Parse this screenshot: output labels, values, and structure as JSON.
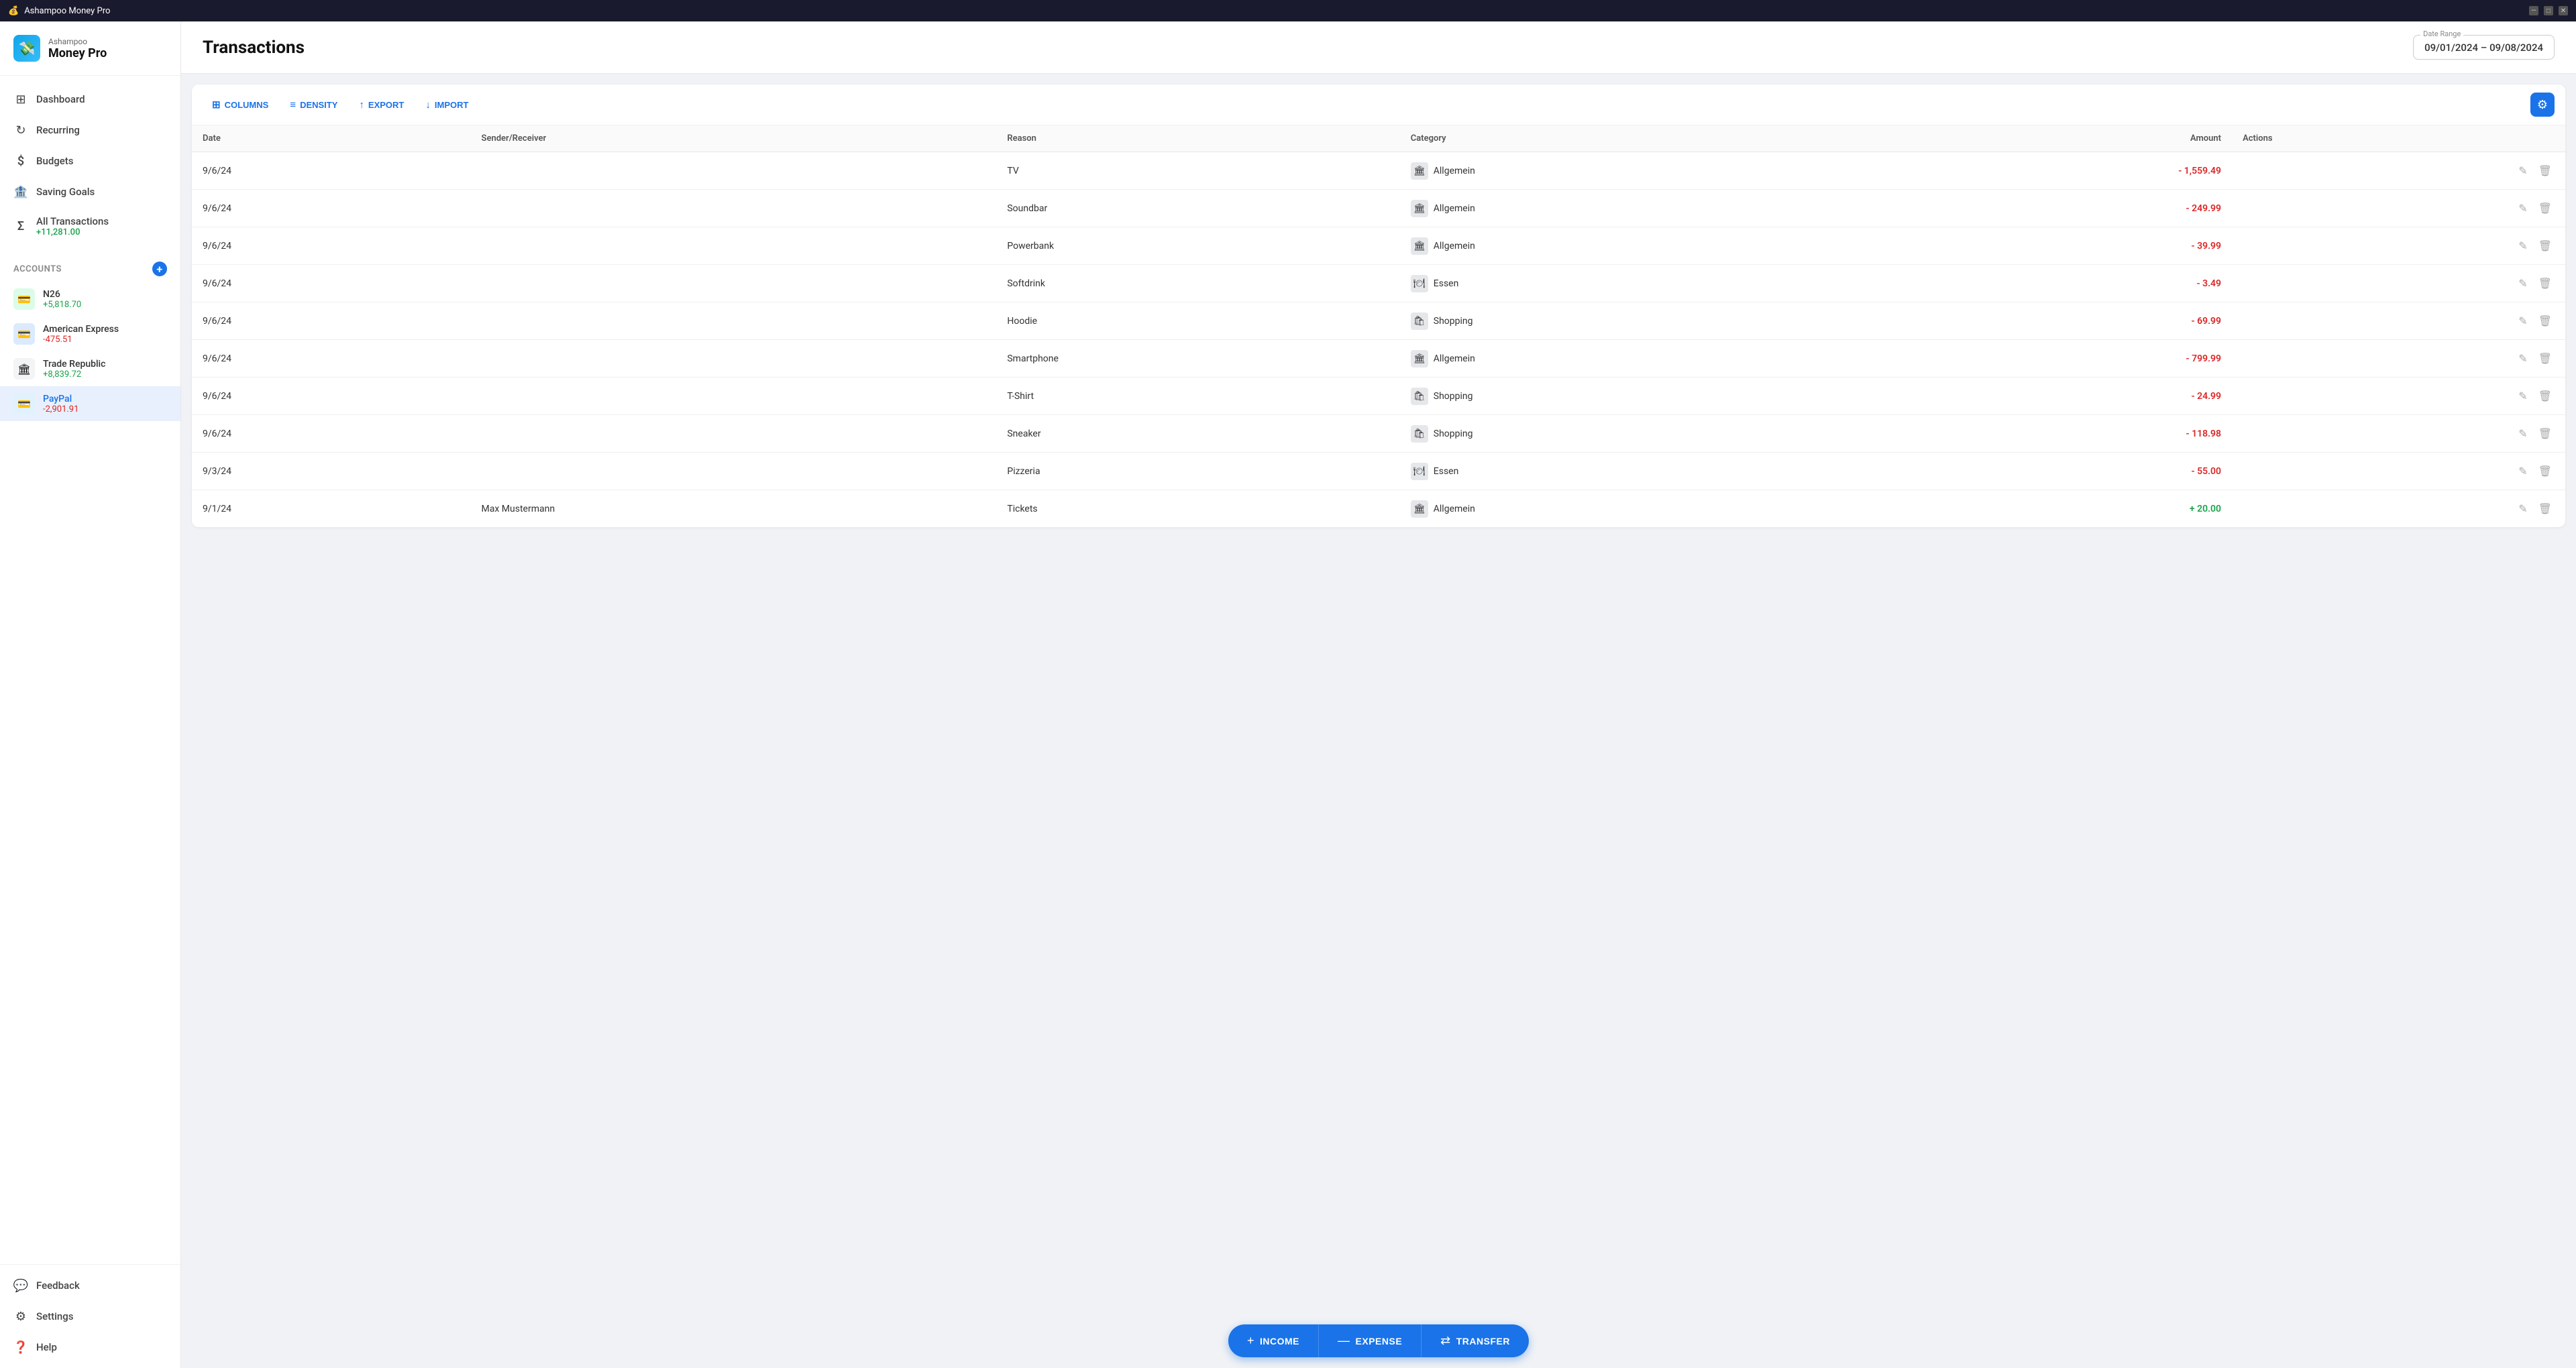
{
  "app": {
    "company": "Ashampoo",
    "product": "Money Pro",
    "title": "Ashampoo Money Pro"
  },
  "titlebar": {
    "minimize": "—",
    "maximize": "□",
    "close": "✕"
  },
  "sidebar": {
    "nav": [
      {
        "id": "dashboard",
        "label": "Dashboard",
        "icon": "⊞"
      },
      {
        "id": "recurring",
        "label": "Recurring",
        "icon": "↻"
      },
      {
        "id": "budgets",
        "label": "Budgets",
        "icon": "💲"
      },
      {
        "id": "saving-goals",
        "label": "Saving Goals",
        "icon": "🏦"
      },
      {
        "id": "all-transactions",
        "label": "All Transactions",
        "icon": "Σ",
        "sub": "+11,281.00",
        "sub_type": "positive"
      }
    ],
    "accounts_label": "Accounts",
    "accounts": [
      {
        "id": "n26",
        "name": "N26",
        "balance": "+5,818.70",
        "type": "positive",
        "icon": "💳",
        "icon_class": "green"
      },
      {
        "id": "amex",
        "name": "American Express",
        "balance": "-475.51",
        "type": "negative",
        "icon": "💳",
        "icon_class": "blue"
      },
      {
        "id": "trade-republic",
        "name": "Trade Republic",
        "balance": "+8,839.72",
        "type": "positive",
        "icon": "🏛",
        "icon_class": "gray"
      },
      {
        "id": "paypal",
        "name": "PayPal",
        "balance": "-2,901.91",
        "type": "negative",
        "icon": "💳",
        "icon_class": "light-blue",
        "active": true
      }
    ],
    "footer_nav": [
      {
        "id": "feedback",
        "label": "Feedback",
        "icon": "💬"
      },
      {
        "id": "settings",
        "label": "Settings",
        "icon": "⚙"
      },
      {
        "id": "help",
        "label": "Help",
        "icon": "❓"
      }
    ]
  },
  "header": {
    "title": "Transactions",
    "date_range_label": "Date Range",
    "date_range_value": "09/01/2024 – 09/08/2024"
  },
  "toolbar": {
    "columns_label": "COLUMNS",
    "density_label": "DENSITY",
    "export_label": "EXPORT",
    "import_label": "IMPORT"
  },
  "table": {
    "columns": [
      "Date",
      "Sender/Receiver",
      "Reason",
      "Category",
      "Amount",
      "Actions"
    ],
    "rows": [
      {
        "date": "9/6/24",
        "sender": "",
        "reason": "TV",
        "category": "Allgemein",
        "cat_icon": "🏛",
        "amount": "-1,559.49",
        "type": "negative"
      },
      {
        "date": "9/6/24",
        "sender": "",
        "reason": "Soundbar",
        "category": "Allgemein",
        "cat_icon": "🏛",
        "amount": "-249.99",
        "type": "negative"
      },
      {
        "date": "9/6/24",
        "sender": "",
        "reason": "Powerbank",
        "category": "Allgemein",
        "cat_icon": "🏛",
        "amount": "-39.99",
        "type": "negative"
      },
      {
        "date": "9/6/24",
        "sender": "",
        "reason": "Softdrink",
        "category": "Essen",
        "cat_icon": "🍽",
        "amount": "-3.49",
        "type": "negative"
      },
      {
        "date": "9/6/24",
        "sender": "",
        "reason": "Hoodie",
        "category": "Shopping",
        "cat_icon": "🛍",
        "amount": "-69.99",
        "type": "negative"
      },
      {
        "date": "9/6/24",
        "sender": "",
        "reason": "Smartphone",
        "category": "Allgemein",
        "cat_icon": "🏛",
        "amount": "-799.99",
        "type": "negative"
      },
      {
        "date": "9/6/24",
        "sender": "",
        "reason": "T-Shirt",
        "category": "Shopping",
        "cat_icon": "🛍",
        "amount": "-24.99",
        "type": "negative"
      },
      {
        "date": "9/6/24",
        "sender": "",
        "reason": "Sneaker",
        "category": "Shopping",
        "cat_icon": "🛍",
        "amount": "-118.98",
        "type": "negative"
      },
      {
        "date": "9/3/24",
        "sender": "",
        "reason": "Pizzeria",
        "category": "Essen",
        "cat_icon": "🍽",
        "amount": "-55.00",
        "type": "negative"
      },
      {
        "date": "9/1/24",
        "sender": "Max Mustermann",
        "reason": "Tickets",
        "category": "Allgemein",
        "cat_icon": "🏛",
        "amount": "+20.00",
        "type": "positive"
      }
    ]
  },
  "actions": {
    "income_label": "INCOME",
    "expense_label": "EXPENSE",
    "transfer_label": "TRANSFER",
    "income_sym": "+",
    "expense_sym": "—",
    "transfer_sym": "⇄"
  }
}
